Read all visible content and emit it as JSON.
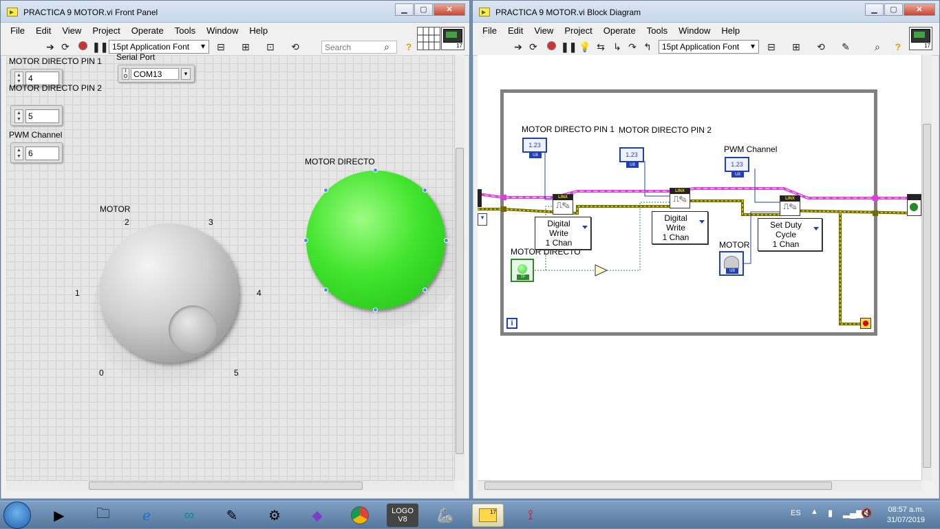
{
  "front_panel": {
    "title": "PRACTICA 9 MOTOR.vi Front Panel",
    "menu": [
      "File",
      "Edit",
      "View",
      "Project",
      "Operate",
      "Tools",
      "Window",
      "Help"
    ],
    "font": "15pt Application Font",
    "search_placeholder": "Search",
    "controls": {
      "pin1_label": "MOTOR DIRECTO PIN 1",
      "pin1_value": "4",
      "pin2_label": "MOTOR  DIRECTO PIN 2",
      "pin2_value": "5",
      "pwm_label": "PWM Channel",
      "pwm_value": "6",
      "serial_label": "Serial Port",
      "serial_value": "COM13",
      "knob_label": "MOTOR",
      "knob_ticks": [
        "0",
        "1",
        "2",
        "3",
        "4",
        "5"
      ],
      "led_label": "MOTOR DIRECTO",
      "led_color": "#3ee02a"
    }
  },
  "block_diagram": {
    "title": "PRACTICA 9 MOTOR.vi Block Diagram",
    "menu": [
      "File",
      "Edit",
      "View",
      "Project",
      "Operate",
      "Tools",
      "Window",
      "Help"
    ],
    "font": "15pt Application Font",
    "labels": {
      "pin1": "MOTOR DIRECTO PIN 1",
      "pin2": "MOTOR  DIRECTO PIN 2",
      "pwm": "PWM Channel",
      "motor_directo": "MOTOR DIRECTO",
      "motor": "MOTOR",
      "type_u8": "U8",
      "type_tf": "TF",
      "numeric": "1.23",
      "linx": "LINX",
      "iteration": "i"
    },
    "selectors": {
      "dw1_line1": "Digital Write",
      "dw1_line2": "1 Chan",
      "dw2_line1": "Digital Write",
      "dw2_line2": "1 Chan",
      "pwm_line1": "Set Duty Cycle",
      "pwm_line2": "1 Chan"
    }
  },
  "taskbar": {
    "language": "ES",
    "time": "08:57 a.m.",
    "date": "31/07/2019",
    "logo_text": "LOGO",
    "logo_version": "V8",
    "labview_badge": "17"
  }
}
